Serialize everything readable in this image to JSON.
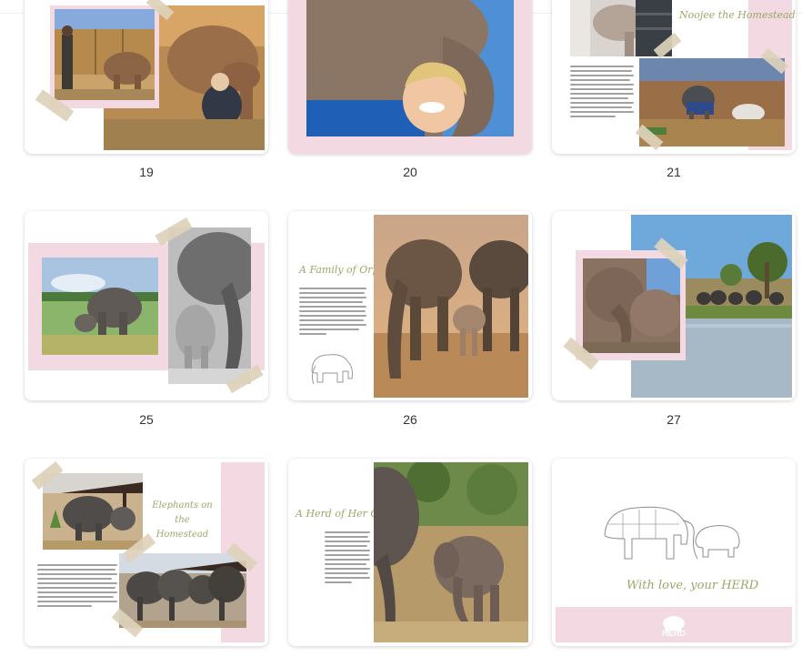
{
  "pages": [
    {
      "number": "19"
    },
    {
      "number": "20"
    },
    {
      "number": "21",
      "script_title": "Noojee the Homestead"
    },
    {
      "number": "25"
    },
    {
      "number": "26",
      "script_title": "A Family of Orphans"
    },
    {
      "number": "27"
    },
    {
      "number": "",
      "script_title": "Elephants on the Homestead"
    },
    {
      "number": "",
      "script_title": "A Herd of Her Own"
    },
    {
      "number": "",
      "script_title": "With love, your HERD",
      "logo_text": "HERD"
    }
  ]
}
